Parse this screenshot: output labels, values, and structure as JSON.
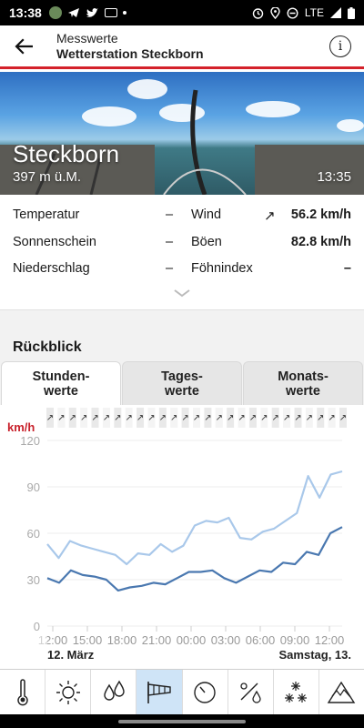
{
  "status_bar": {
    "time": "13:38",
    "network": "LTE"
  },
  "header": {
    "subtitle": "Messwerte",
    "title": "Wetterstation Steckborn"
  },
  "hero": {
    "place": "Steckborn",
    "altitude": "397 m ü.M.",
    "time": "13:35"
  },
  "values": {
    "temperatur_label": "Temperatur",
    "temperatur_value": "–",
    "sonnenschein_label": "Sonnenschein",
    "sonnenschein_value": "–",
    "niederschlag_label": "Niederschlag",
    "niederschlag_value": "–",
    "wind_label": "Wind",
    "wind_value": "56.2 km/h",
    "boeen_label": "Böen",
    "boeen_value": "82.8 km/h",
    "foehn_label": "Föhnindex",
    "foehn_value": "–"
  },
  "section_title": "Rückblick",
  "tabs": [
    {
      "line1": "Stunden-",
      "line2": "werte",
      "active": true
    },
    {
      "line1": "Tages-",
      "line2": "werte",
      "active": false
    },
    {
      "line1": "Monats-",
      "line2": "werte",
      "active": false
    }
  ],
  "chart_data": {
    "type": "line",
    "unit_label": "km/h",
    "yticks": [
      0,
      30,
      60,
      90,
      120
    ],
    "ylim": [
      0,
      120
    ],
    "x_tick_labels": [
      "12:00",
      "15:00",
      "18:00",
      "21:00",
      "00:00",
      "03:00",
      "06:00",
      "09:00",
      "12:00"
    ],
    "date_labels": [
      "12. März",
      "Samstag, 13."
    ],
    "grid": true,
    "series": [
      {
        "color": "#a9c8ea",
        "values": [
          53,
          44,
          55,
          52,
          50,
          48,
          46,
          40,
          47,
          46,
          53,
          48,
          52,
          65,
          68,
          67,
          70,
          57,
          56,
          61,
          63,
          68,
          73,
          97,
          83,
          98,
          100
        ]
      },
      {
        "color": "#4a78b0",
        "values": [
          31,
          28,
          36,
          33,
          32,
          30,
          23,
          25,
          26,
          28,
          27,
          31,
          35,
          35,
          36,
          31,
          28,
          32,
          36,
          35,
          41,
          40,
          48,
          46,
          60,
          64
        ]
      }
    ],
    "wind_direction_arrows": 27
  },
  "nav": [
    {
      "icon": "thermometer-icon",
      "active": false
    },
    {
      "icon": "sun-icon",
      "active": false
    },
    {
      "icon": "raindrops-icon",
      "active": false
    },
    {
      "icon": "windsock-icon",
      "active": true
    },
    {
      "icon": "pressure-gauge-icon",
      "active": false
    },
    {
      "icon": "humidity-icon",
      "active": false
    },
    {
      "icon": "snowflake-icon",
      "active": false
    },
    {
      "icon": "warning-icon",
      "active": false
    }
  ]
}
